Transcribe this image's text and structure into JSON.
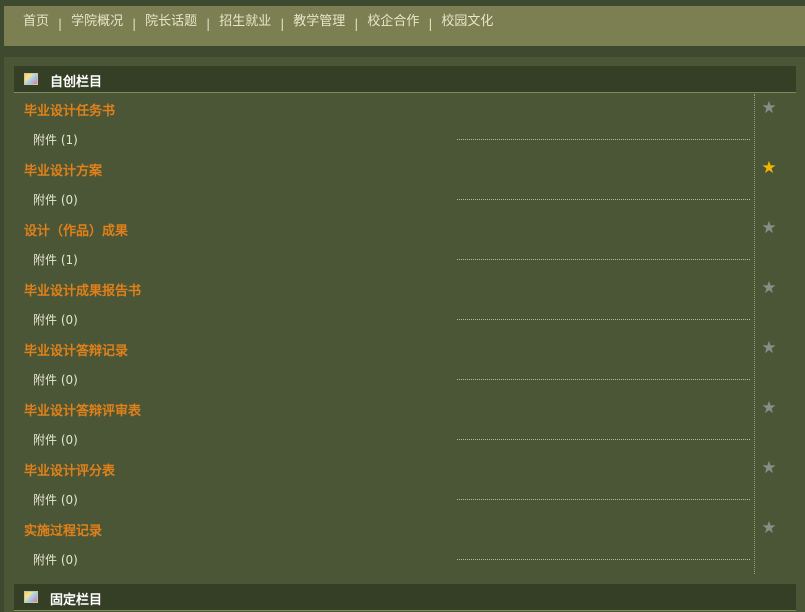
{
  "nav": {
    "items": [
      "首页",
      "学院概况",
      "院长话题",
      "招生就业",
      "教学管理",
      "校企合作",
      "校园文化"
    ],
    "separator": "|"
  },
  "sections": [
    {
      "title": "自创栏目",
      "items": [
        {
          "title": "毕业设计任务书",
          "attachments": "附件 (1)",
          "starred": false
        },
        {
          "title": "毕业设计方案",
          "attachments": "附件 (0)",
          "starred": true
        },
        {
          "title": "设计（作品）成果",
          "attachments": "附件 (1)",
          "starred": false
        },
        {
          "title": "毕业设计成果报告书",
          "attachments": "附件 (0)",
          "starred": false
        },
        {
          "title": "毕业设计答辩记录",
          "attachments": "附件 (0)",
          "starred": false
        },
        {
          "title": "毕业设计答辩评审表",
          "attachments": "附件 (0)",
          "starred": false
        },
        {
          "title": "毕业设计评分表",
          "attachments": "附件 (0)",
          "starred": false
        },
        {
          "title": "实施过程记录",
          "attachments": "附件 (0)",
          "starred": false
        }
      ]
    },
    {
      "title": "固定栏目",
      "items": []
    }
  ],
  "icons": {
    "star": "star-icon",
    "section": "section-icon"
  },
  "colors": {
    "accent": "#e0801a",
    "star_on": "#f5b400",
    "star_off": "#8c8c86"
  }
}
